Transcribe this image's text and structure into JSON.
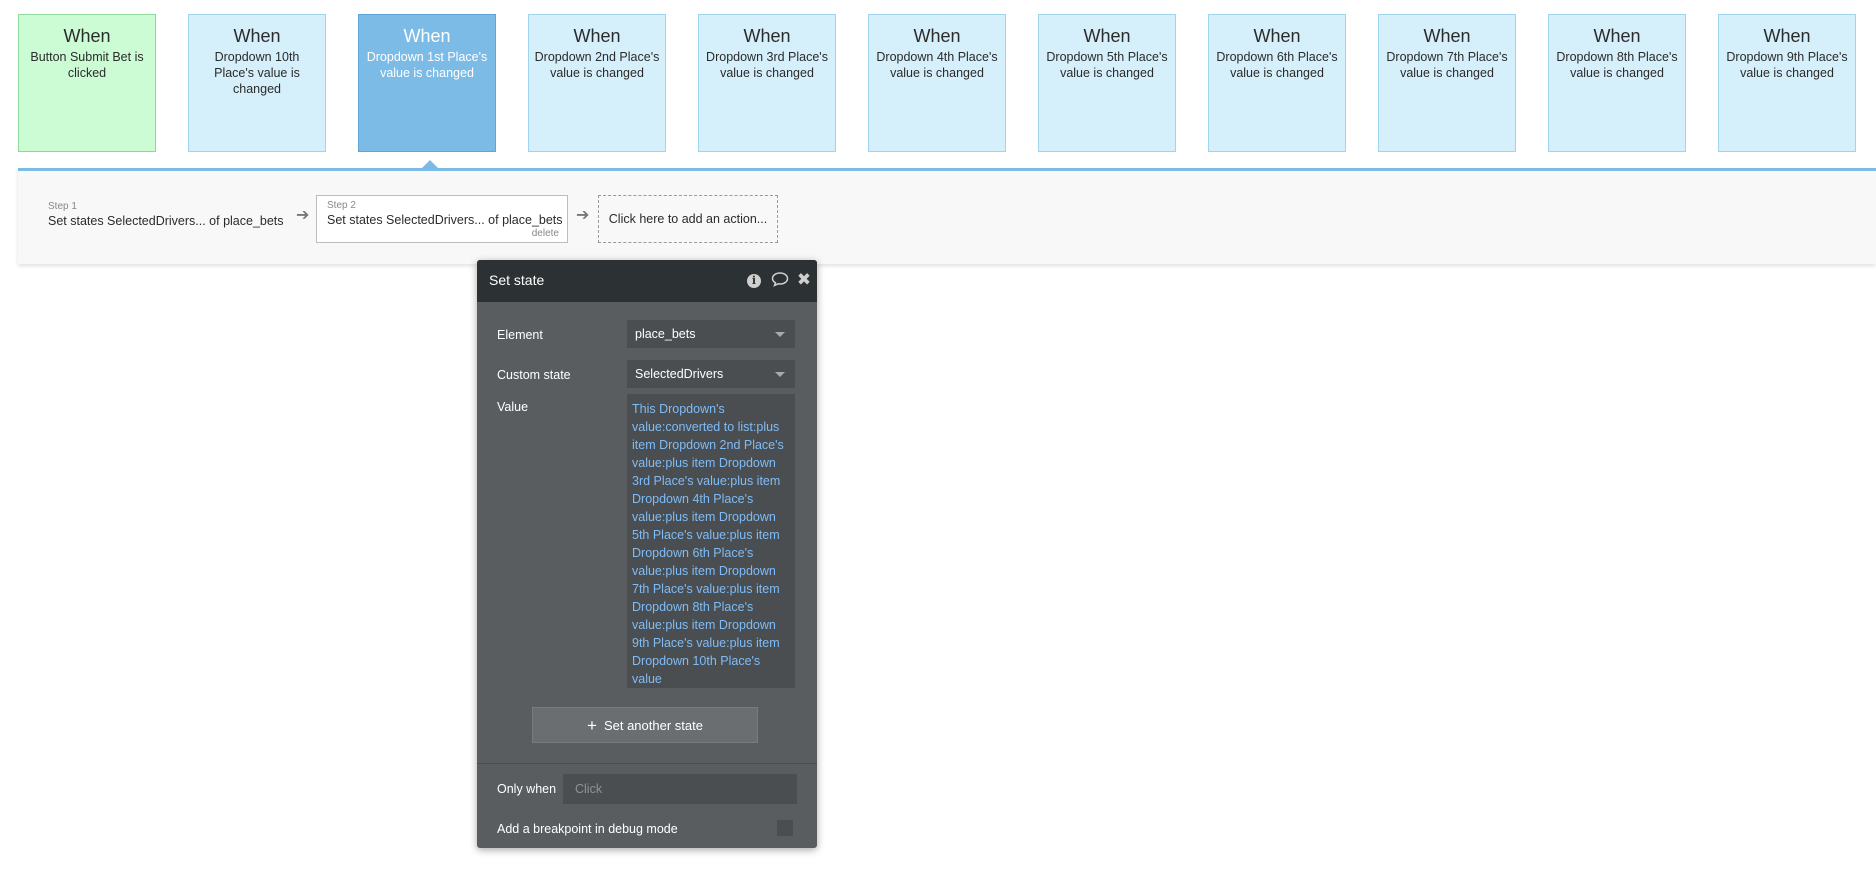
{
  "events": [
    {
      "when": "When",
      "desc": "Button Submit Bet is clicked"
    },
    {
      "when": "When",
      "desc": "Dropdown 10th Place's value is changed"
    },
    {
      "when": "When",
      "desc": "Dropdown 1st Place's value is changed"
    },
    {
      "when": "When",
      "desc": "Dropdown 2nd Place's value is changed"
    },
    {
      "when": "When",
      "desc": "Dropdown 3rd Place's value is changed"
    },
    {
      "when": "When",
      "desc": "Dropdown 4th Place's value is changed"
    },
    {
      "when": "When",
      "desc": "Dropdown 5th Place's value is changed"
    },
    {
      "when": "When",
      "desc": "Dropdown 6th Place's value is changed"
    },
    {
      "when": "When",
      "desc": "Dropdown 7th Place's value is changed"
    },
    {
      "when": "When",
      "desc": "Dropdown 8th Place's value is changed"
    },
    {
      "when": "When",
      "desc": "Dropdown 9th Place's value is changed"
    }
  ],
  "steps": {
    "step1": {
      "num": "Step 1",
      "text": "Set states SelectedDrivers... of place_bets"
    },
    "step2": {
      "num": "Step 2",
      "text": "Set states SelectedDrivers... of place_bets",
      "delete": "delete"
    },
    "add_action": "Click here to add an action..."
  },
  "panel": {
    "title": "Set state",
    "element_label": "Element",
    "element_value": "place_bets",
    "custom_state_label": "Custom state",
    "custom_state_value": "SelectedDrivers",
    "value_label": "Value",
    "value_expression": "This Dropdown's value:converted to list:plus item Dropdown 2nd Place's value:plus item Dropdown 3rd Place's value:plus item Dropdown 4th Place's value:plus item Dropdown 5th Place's value:plus item Dropdown 6th Place's value:plus item Dropdown 7th Place's value:plus item Dropdown 8th Place's value:plus item Dropdown 9th Place's value:plus item Dropdown 10th Place's value",
    "set_another_label": "Set another state",
    "only_when_label": "Only when",
    "only_when_placeholder": "Click",
    "breakpoint_label": "Add a breakpoint in debug mode"
  },
  "colors": {
    "event_default": "#d5effb",
    "event_first": "#ccfcd4",
    "event_selected": "#7bbbe6",
    "panel_bg": "#595d60",
    "panel_header": "#2c3133",
    "expression_text": "#7fbcf7"
  },
  "icons": [
    "info-icon",
    "comment-icon",
    "close-icon",
    "arrow-right-icon",
    "plus-icon",
    "chevron-down-icon"
  ]
}
